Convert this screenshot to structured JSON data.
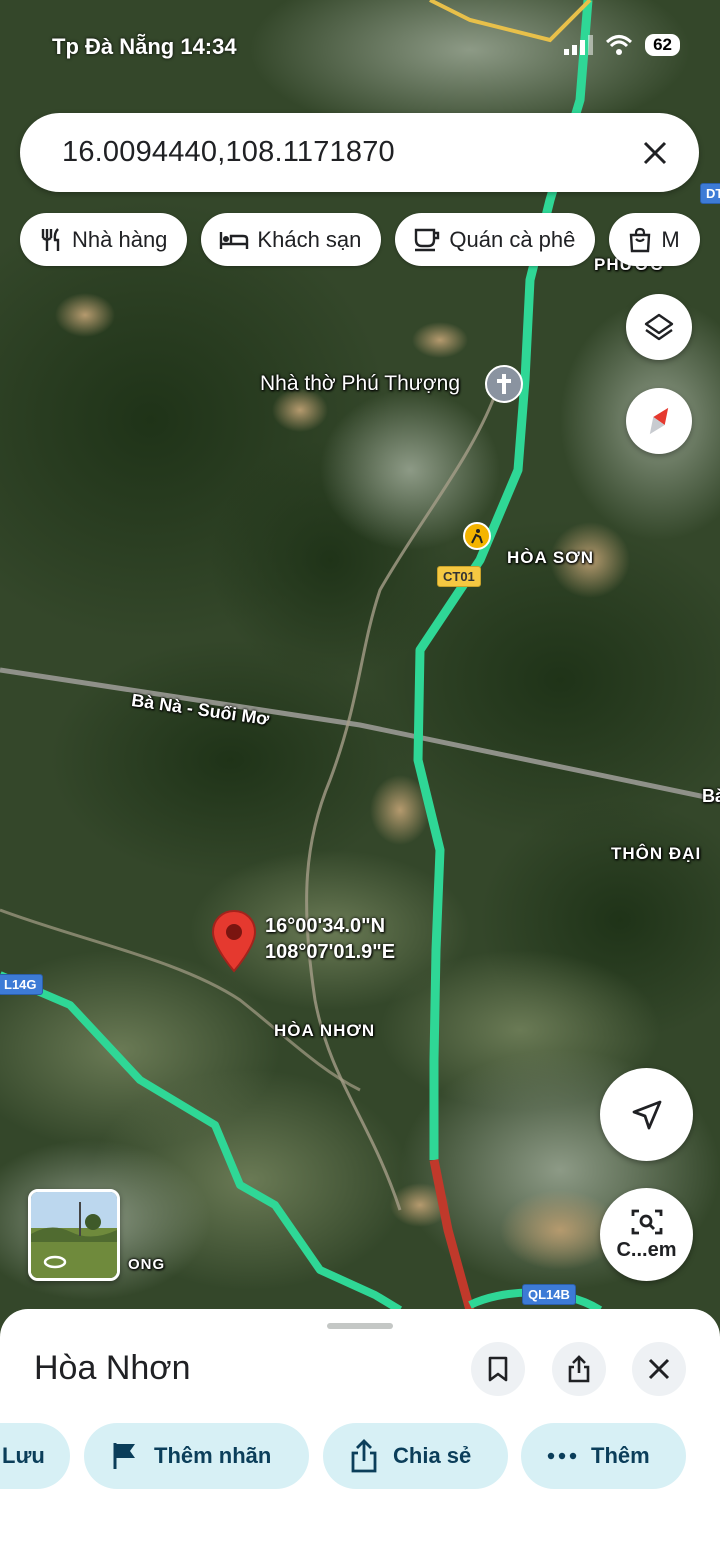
{
  "status_bar": {
    "time": "Tp Đà Nẵng 14:34",
    "battery": "62"
  },
  "search": {
    "query": "16.0094440,108.1171870"
  },
  "chips": [
    {
      "label": "Nhà hàng",
      "icon": "restaurant-icon"
    },
    {
      "label": "Khách sạn",
      "icon": "hotel-icon"
    },
    {
      "label": "Quán cà phê",
      "icon": "coffee-icon"
    },
    {
      "label": "M",
      "icon": "shopping-bag-icon"
    }
  ],
  "map": {
    "poi": "Nhà thờ Phú Thượng",
    "labels": {
      "hoa_son": "HÒA SƠN",
      "thon_dai": "THÔN ĐẠI",
      "hoa_nhon": "HÒA NHƠN",
      "phuoc": "PHƯỚC",
      "ba_na_road": "Bà Nà - Suối Mơ",
      "ba_right": "Bà",
      "ong": "ONG",
      "dt": "DT"
    },
    "shields": {
      "ct01": "CT01",
      "ql14b": "QL14B",
      "l14g": "L14G"
    },
    "pin_coords": {
      "lat": "16°00'34.0\"N",
      "lng": "108°07'01.9\"E"
    },
    "colors": {
      "traffic_green": "#2fd796",
      "traffic_red": "#c0392b",
      "pin": "#e5392f"
    }
  },
  "controls": {
    "lens_label": "C...em"
  },
  "sheet": {
    "title": "Hòa Nhơn",
    "actions": [
      {
        "label": "Lưu",
        "icon": "bookmark-icon"
      },
      {
        "label": "Thêm nhãn",
        "icon": "flag-icon"
      },
      {
        "label": "Chia sẻ",
        "icon": "share-icon"
      },
      {
        "label": "Thêm",
        "icon": "more-icon"
      }
    ]
  }
}
